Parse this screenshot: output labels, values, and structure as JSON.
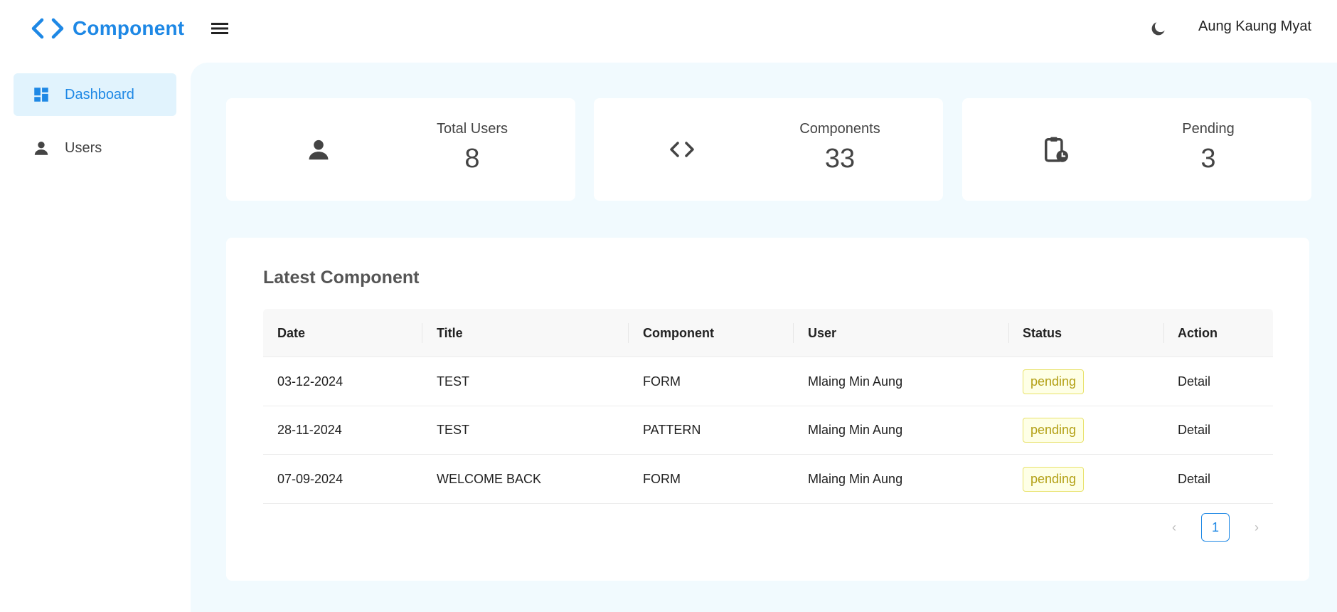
{
  "header": {
    "brand": "Component",
    "user_name": "Aung Kaung Myat",
    "brand_color": "#1e88e5"
  },
  "sidebar": {
    "items": [
      {
        "label": "Dashboard",
        "icon": "dashboard-icon",
        "active": true
      },
      {
        "label": "Users",
        "icon": "person-icon",
        "active": false
      }
    ]
  },
  "stats": [
    {
      "label": "Total Users",
      "value": "8",
      "icon": "person-icon"
    },
    {
      "label": "Components",
      "value": "33",
      "icon": "code-icon"
    },
    {
      "label": "Pending",
      "value": "3",
      "icon": "clipboard-clock-icon"
    }
  ],
  "latest": {
    "title": "Latest Component",
    "columns": [
      "Date",
      "Title",
      "Component",
      "User",
      "Status",
      "Action"
    ],
    "rows": [
      {
        "date": "03-12-2024",
        "title": "TEST",
        "component": "FORM",
        "user": "Mlaing Min Aung",
        "status": "pending",
        "action": "Detail"
      },
      {
        "date": "28-11-2024",
        "title": "TEST",
        "component": "PATTERN",
        "user": "Mlaing Min Aung",
        "status": "pending",
        "action": "Detail"
      },
      {
        "date": "07-09-2024",
        "title": "WELCOME BACK",
        "component": "FORM",
        "user": "Mlaing Min Aung",
        "status": "pending",
        "action": "Detail"
      }
    ],
    "pagination": {
      "current": "1",
      "prev": "‹",
      "next": "›"
    }
  }
}
